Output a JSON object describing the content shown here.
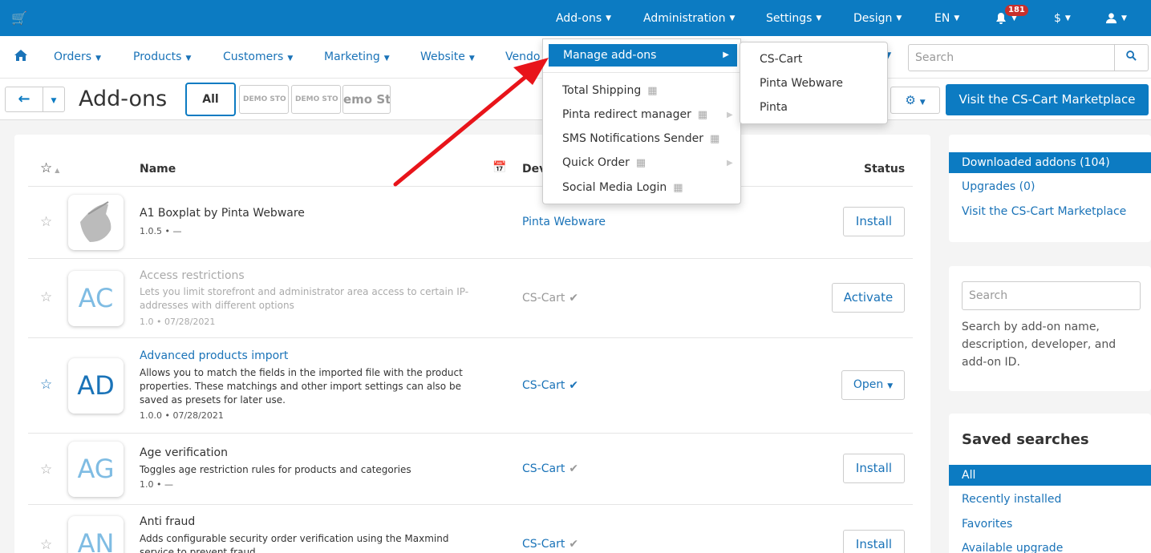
{
  "topbar": {
    "cart_icon": "cart-icon",
    "menu": [
      "Add-ons",
      "Administration",
      "Settings",
      "Design",
      "EN"
    ],
    "notifications_count": "181",
    "currency": "$"
  },
  "secondary_nav": {
    "items": [
      "Orders",
      "Products",
      "Customers",
      "Marketing",
      "Website",
      "Vendo"
    ],
    "search_placeholder": "Search"
  },
  "titlebar": {
    "title": "Add-ons",
    "filter_all": "All",
    "storefronts": [
      "DEMO STO",
      "DEMO STO",
      "emo Sto"
    ],
    "marketplace_button": "Visit the CS-Cart Marketplace"
  },
  "table": {
    "headers": {
      "name": "Name",
      "developer": "Dev",
      "status": "Status"
    },
    "rows": [
      {
        "name": "A1 Boxplat by Pinta Webware",
        "desc": "",
        "version": "1.0.5 • —",
        "developer": "Pinta Webware",
        "action": "Install"
      },
      {
        "name": "Access restrictions",
        "logo": "AC",
        "desc": "Lets you limit storefront and administrator area access to certain IP-addresses with different options",
        "version": "1.0 • 07/28/2021",
        "developer": "CS-Cart",
        "action": "Activate"
      },
      {
        "name": "Advanced products import",
        "logo": "AD",
        "desc": "Allows you to match the fields in the imported file with the product properties. These matchings and other import settings can also be saved as presets for later use.",
        "version": "1.0.0 • 07/28/2021",
        "developer": "CS-Cart",
        "action": "Open"
      },
      {
        "name": "Age verification",
        "logo": "AG",
        "desc": "Toggles age restriction rules for products and categories",
        "version": "1.0 • —",
        "developer": "CS-Cart",
        "action": "Install"
      },
      {
        "name": "Anti fraud",
        "logo": "AN",
        "desc": "Adds configurable security order verification using the Maxmind service to prevent fraud",
        "version": "",
        "developer": "CS-Cart",
        "action": "Install"
      }
    ]
  },
  "sidebar": {
    "links": [
      "Downloaded addons (104)",
      "Upgrades (0)",
      "Visit the CS-Cart Marketplace"
    ],
    "search_placeholder": "Search",
    "search_help": "Search by add-on name, description, developer, and add-on ID.",
    "saved_title": "Saved searches",
    "saved": [
      "All",
      "Recently installed",
      "Favorites",
      "Available upgrade"
    ]
  },
  "dropdown": {
    "highlighted": "Manage add-ons",
    "items": [
      "Total Shipping",
      "Pinta redirect manager",
      "SMS Notifications Sender",
      "Quick Order",
      "Social Media Login"
    ],
    "submenu": [
      "CS-Cart",
      "Pinta Webware",
      "Pinta"
    ]
  },
  "colors": {
    "primary": "#0c7bc2",
    "link": "#1a73b8",
    "badge": "#c9302c",
    "arrow": "#e8141a"
  }
}
